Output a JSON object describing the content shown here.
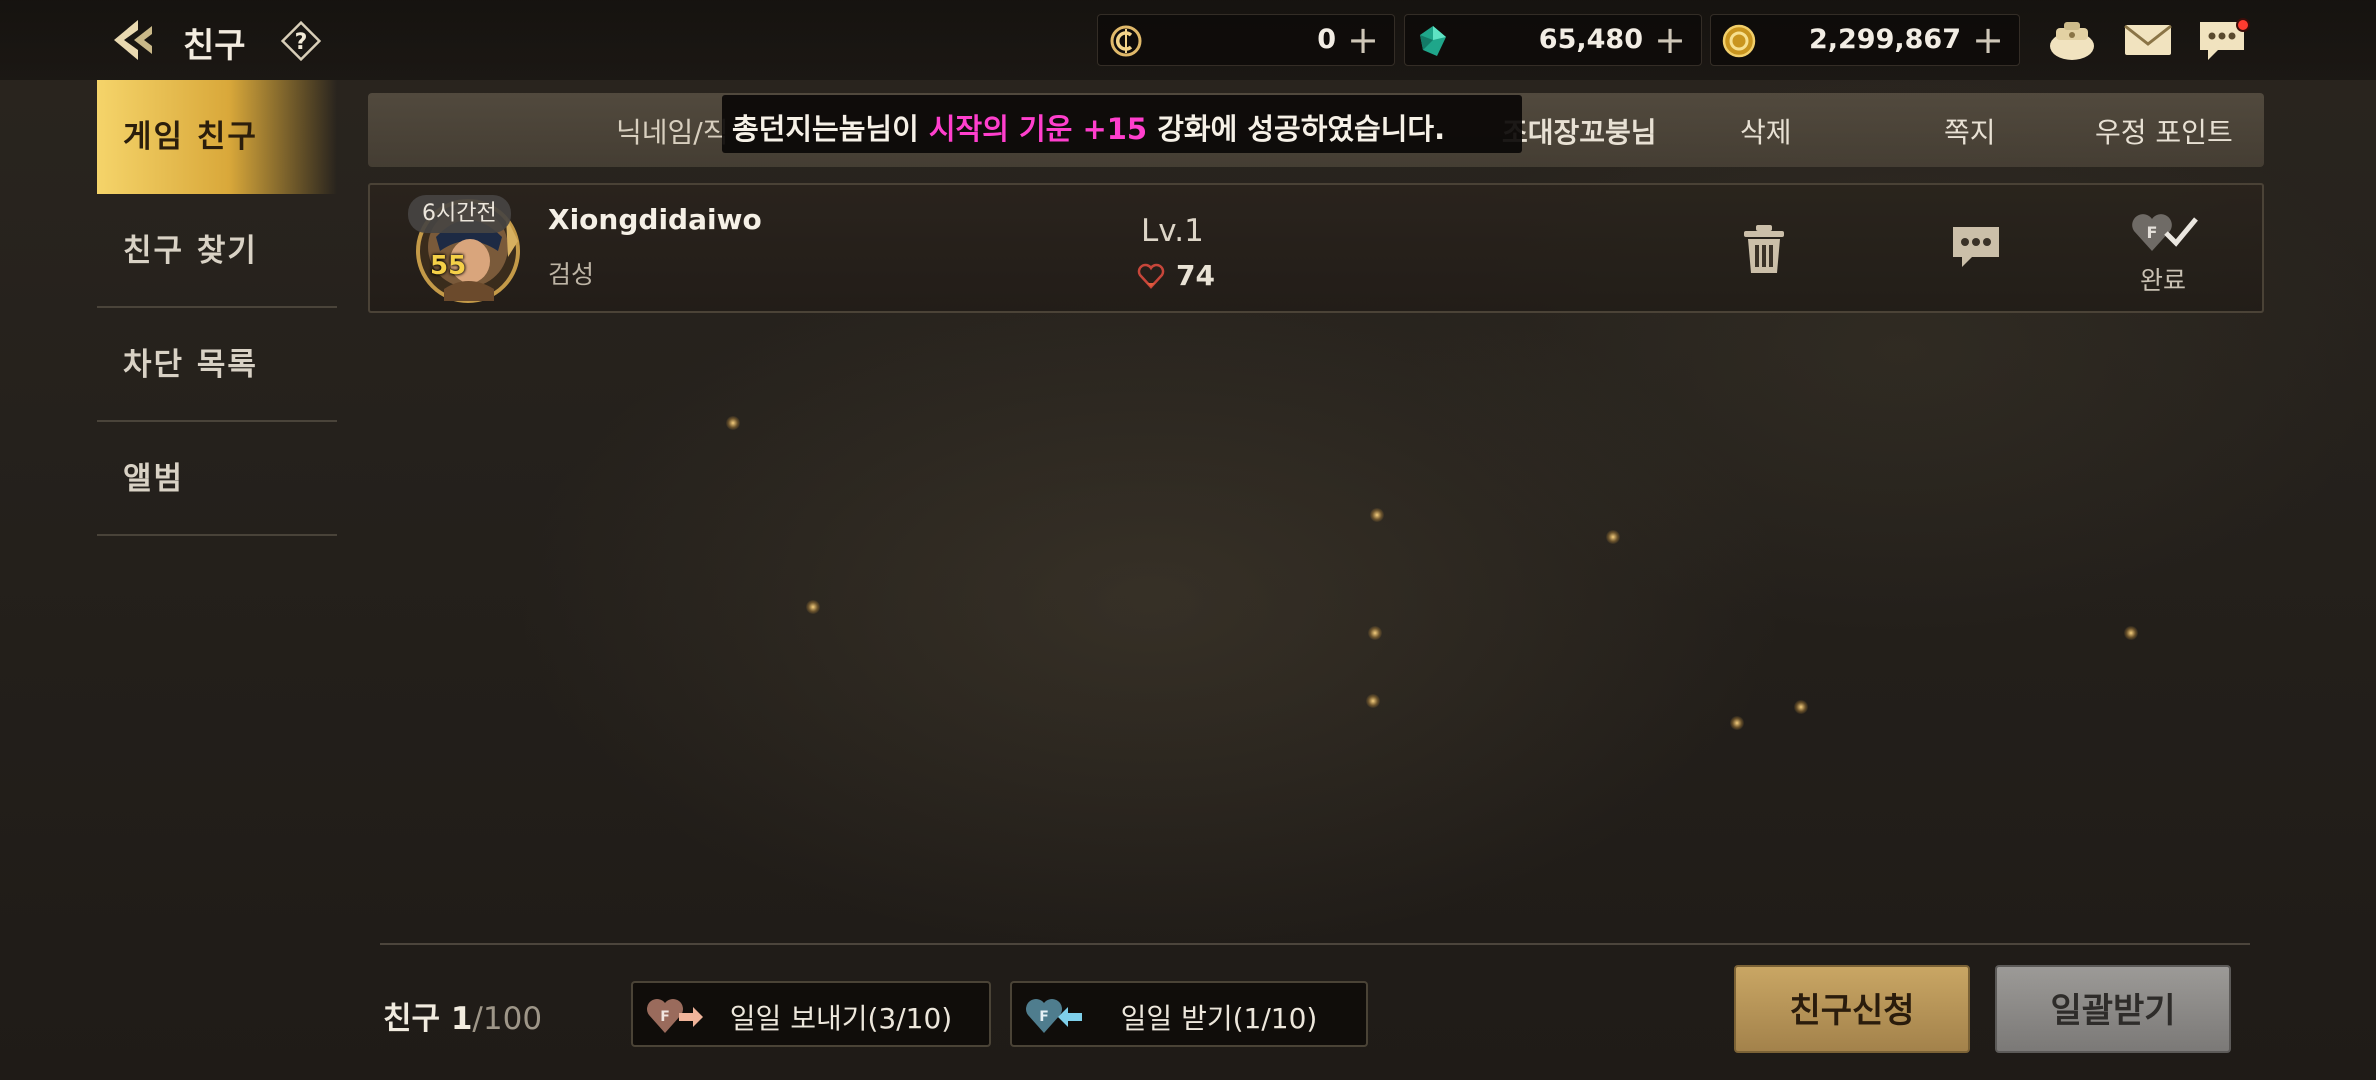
{
  "header": {
    "title": "친구",
    "currencies": [
      {
        "name": "crystal-coin",
        "value": "0"
      },
      {
        "name": "gem",
        "value": "65,480"
      },
      {
        "name": "gold",
        "value": "2,299,867"
      }
    ]
  },
  "sidebar": {
    "items": [
      {
        "label": "게임 친구",
        "active": true
      },
      {
        "label": "친구 찾기",
        "active": false
      },
      {
        "label": "차단 목록",
        "active": false
      },
      {
        "label": "앨범",
        "active": false
      }
    ]
  },
  "list_header": {
    "col_name": "닉네임/직",
    "col_leader": "조대장꼬붕님",
    "col_delete": "삭제",
    "col_message": "쪽지",
    "col_points": "우정 포인트"
  },
  "notice": {
    "before": "총던지는놈님이 ",
    "highlight": "시작의 기운 +15",
    "after": " 강화에 성공하였습니다."
  },
  "friends": [
    {
      "time": "6시간전",
      "level_badge": "55",
      "name": "Xiongdidaiwo",
      "class": "검성",
      "level": "Lv.1",
      "hearts": "74",
      "points_status": "완료"
    }
  ],
  "footer": {
    "count_label": "친구",
    "count_current": "1",
    "count_max": "/100",
    "send_daily": "일일 보내기(3/10)",
    "receive_daily": "일일 받기(1/10)",
    "request_button": "친구신청",
    "receive_all_button": "일괄받기"
  },
  "colors": {
    "active_tab": "#e6b84a",
    "notice_highlight": "#ff3fcd",
    "request_button": "#b8955a",
    "receive_all_button": "#8c8a88"
  }
}
